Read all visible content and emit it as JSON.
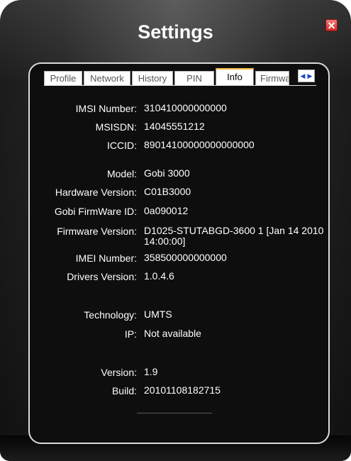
{
  "window": {
    "title": "Settings"
  },
  "tabs": [
    {
      "label": "Profile",
      "active": false
    },
    {
      "label": "Network",
      "active": false
    },
    {
      "label": "History",
      "active": false
    },
    {
      "label": "PIN",
      "active": false
    },
    {
      "label": "Info",
      "active": true
    },
    {
      "label": "Firmware",
      "active": false
    }
  ],
  "info": {
    "imsi": {
      "label": "IMSI Number:",
      "value": "310410000000000"
    },
    "msisdn": {
      "label": "MSISDN:",
      "value": "14045551212"
    },
    "iccid": {
      "label": "ICCID:",
      "value": "89014100000000000000"
    },
    "model": {
      "label": "Model:",
      "value": "Gobi 3000"
    },
    "hardware_version": {
      "label": "Hardware Version:",
      "value": "C01B3000"
    },
    "gobi_firmware_id": {
      "label": "Gobi FirmWare ID:",
      "value": "0a090012"
    },
    "firmware_version": {
      "label": "Firmware Version:",
      "value": "D1025-STUTABGD-3600  1  [Jan 14 2010 14:00:00]"
    },
    "imei": {
      "label": "IMEI Number:",
      "value": "358500000000000"
    },
    "drivers_version": {
      "label": "Drivers Version:",
      "value": "1.0.4.6"
    },
    "technology": {
      "label": "Technology:",
      "value": "UMTS"
    },
    "ip": {
      "label": "IP:",
      "value": "Not available"
    },
    "version": {
      "label": "Version:",
      "value": "1.9"
    },
    "build": {
      "label": "Build:",
      "value": "20101108182715"
    }
  },
  "colors": {
    "accent_tab": "#f5b940",
    "close": "#d82a2a",
    "background": "#1a1a1a"
  }
}
